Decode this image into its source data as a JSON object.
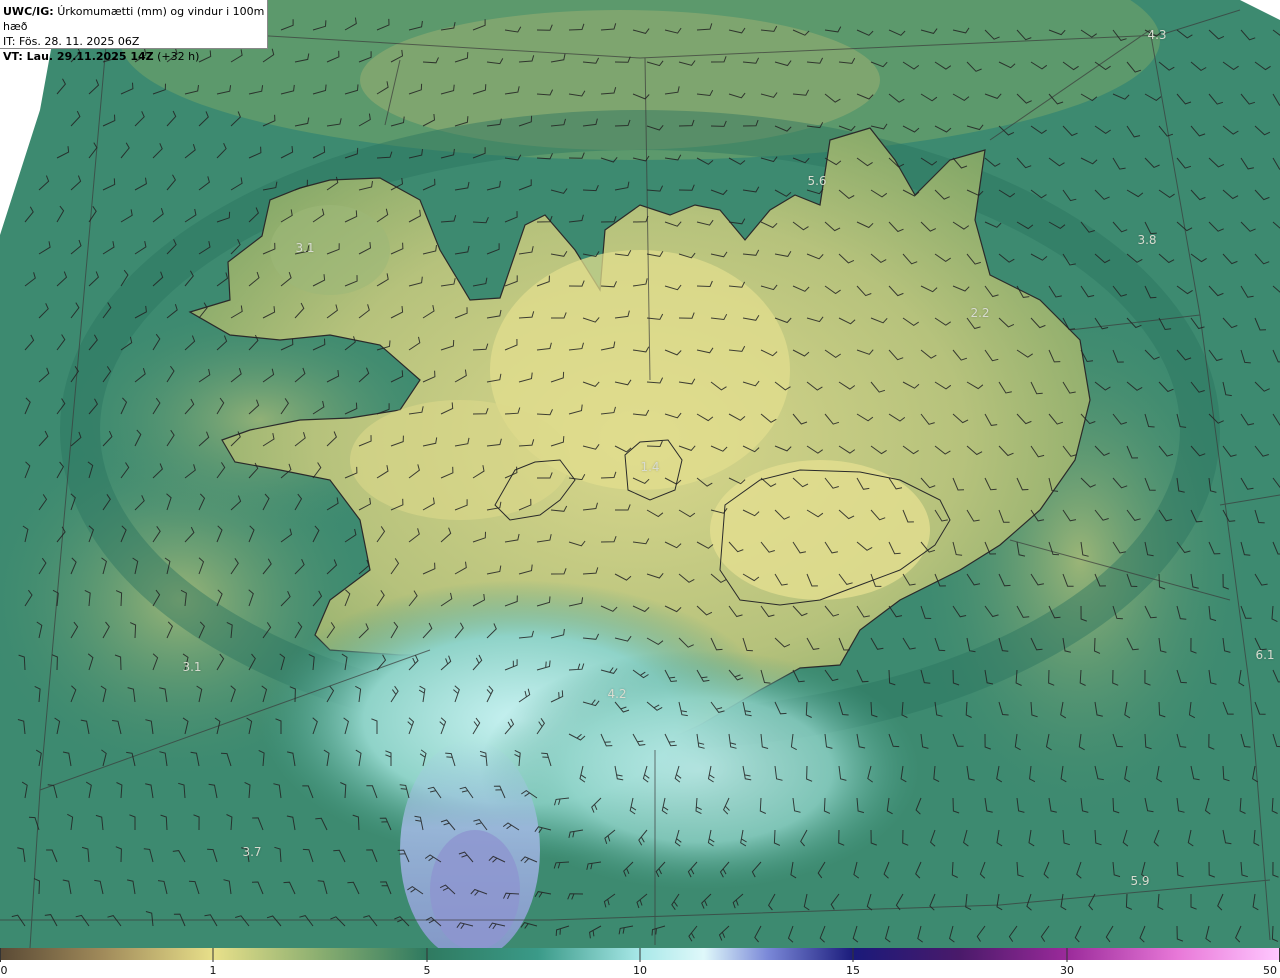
{
  "header": {
    "title_prefix": "UWC/IG:",
    "title_rest": "Úrkomumætti (mm) og vindur i 100m hæð",
    "it_line": "IT: Fös. 28. 11. 2025 06Z",
    "vt_prefix": "VT: Lau. 29.11.2025 14Z",
    "vt_suffix": "(+32 h)"
  },
  "value_labels": [
    {
      "text": "4.3"
    },
    {
      "text": "5.6"
    },
    {
      "text": "3.1"
    },
    {
      "text": "3.8"
    },
    {
      "text": "2.2"
    },
    {
      "text": "1.4"
    },
    {
      "text": "4.2"
    },
    {
      "text": "3.1"
    },
    {
      "text": "6.1"
    },
    {
      "text": "3.7"
    },
    {
      "text": "5.9"
    }
  ],
  "colorbar": {
    "ticks": [
      "0",
      "1",
      "5",
      "10",
      "15",
      "30",
      "50"
    ],
    "colors": [
      "#5a4a35",
      "#b8a36a",
      "#e8e08a",
      "#2f7a60",
      "#2f8a78",
      "#a8e8e8",
      "#ffffff",
      "#3a3ab0",
      "#1a1a7a",
      "#2a1a5a",
      "#8a2a8a",
      "#e060c0",
      "#ffb0ff"
    ]
  },
  "map_colors": {
    "ocean_dark": "#2e7a66",
    "ocean_mid": "#3f8e72",
    "land_yellow": "#d8d88a",
    "land_green": "#8aaa6a",
    "high_cyan": "#b9eef0",
    "high_blue": "#8aa0d8"
  }
}
